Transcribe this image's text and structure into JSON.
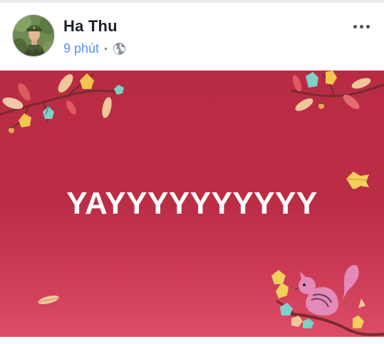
{
  "post": {
    "author_name": "Ha Thu",
    "timestamp": "9 phút",
    "separator": "•",
    "privacy_icon": "globe-icon",
    "more_icon": "more-options-icon",
    "message": "YAYYYYYYYYYY"
  },
  "colors": {
    "background_top": "#b82c43",
    "background_bottom": "#dc4d66",
    "link_blue": "#5890ff",
    "name_text": "#1d2129"
  }
}
